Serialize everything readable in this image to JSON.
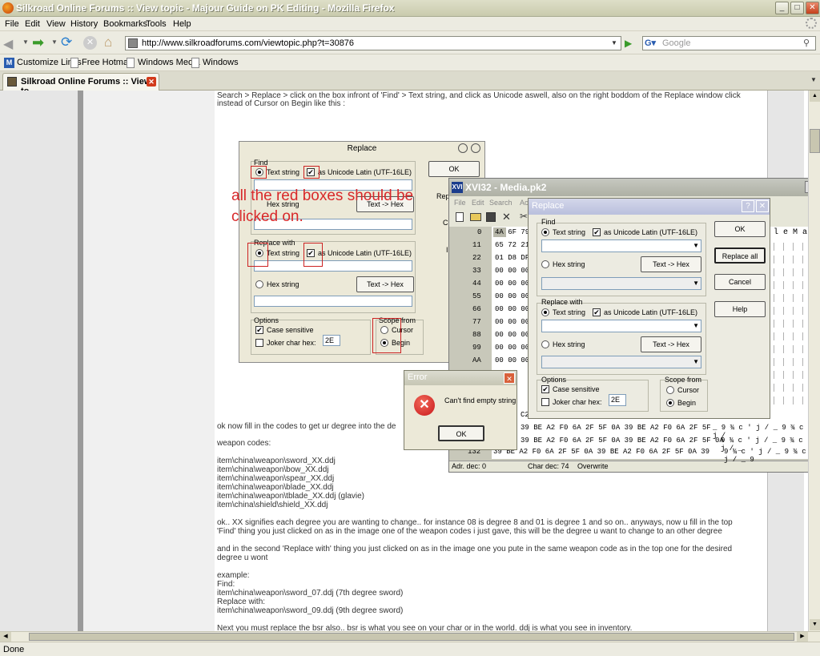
{
  "window": {
    "title": "Silkroad Online Forums :: View topic - Majour Guide on PK Editing - Mozilla Firefox"
  },
  "menu": [
    "File",
    "Edit",
    "View",
    "History",
    "Bookmarks",
    "Tools",
    "Help"
  ],
  "nav": {
    "url": "http://www.silkroadforums.com/viewtopic.php?t=30876",
    "search_placeholder": "Google"
  },
  "bookmarks": [
    "Customize Links",
    "Free Hotmail",
    "Windows Media",
    "Windows"
  ],
  "tab": {
    "label": "Silkroad Online Forums :: View to..."
  },
  "post": {
    "intro": [
      "Search > Replace > click on the box infront of 'Find' > Text string, and click as Unicode aswell, also on the right boddom of the Replace window click",
      "instead of Cursor on Begin like this :"
    ],
    "after_image": "ok now fill in the codes to get ur degree into the de",
    "weapon_codes_label": "weapon codes:",
    "codes": [
      "item\\china\\weapon\\sword_XX.ddj",
      "item\\china\\weapon\\bow_XX.ddj",
      "item\\china\\weapon\\spear_XX.ddj",
      "item\\china\\weapon\\blade_XX.ddj",
      "item\\china\\weapon\\tblade_XX.ddj (glavie)",
      "item\\china\\shield\\shield_XX.ddj"
    ],
    "para1": [
      "ok.. XX signifies each degree you are wanting to change.. for instance 08 is degree 8 and 01 is degree 1 and so on.. anyways, now u fill in the top",
      "'Find' thing you just clicked on as in the image one of the weapon codes i just gave, this will be the degree u want to change to an other degree"
    ],
    "para2": [
      "and in the second 'Replace with' thing you just clicked on as in the image one you pute in the same weapon code as in the top one for the desired",
      "degree u wont"
    ],
    "example": [
      "example:",
      "Find:",
      "item\\china\\weapon\\sword_07.ddj (7th degree sword)",
      "Replace with:",
      "item\\china\\weapon\\sword_09.ddj (9th degree sword)"
    ],
    "last": "Next you must replace the bsr also.. bsr is what you see on your char or in the world. ddj is what you see in inventory."
  },
  "small_dialog": {
    "title": "Replace",
    "find": "Find",
    "text_string": "Text string",
    "unicode": "as Unicode Latin (UTF-16LE)",
    "hex_string": "Hex string",
    "text_to_hex": "Text -> Hex",
    "replace_with": "Replace with",
    "options": "Options",
    "case": "Case sensitive",
    "joker": "Joker char hex:",
    "joker_val": "2E",
    "scope": "Scope from",
    "cursor": "Cursor",
    "begin": "Begin",
    "ok": "OK",
    "rep": "Rep",
    "c": "C",
    "i": "I"
  },
  "annotation": [
    "all the red boxes should be",
    "clicked on."
  ],
  "hex_window": {
    "title": "XVI32 - Media.pk2",
    "menu": [
      "File",
      "Edit",
      "Search",
      "Ac"
    ],
    "offsets": [
      "0",
      "11",
      "22",
      "33",
      "44",
      "55",
      "66",
      "77",
      "88",
      "99",
      "AA"
    ],
    "row0": "4A 6F 79",
    "row1": "65 72 21",
    "row2": "01 D8 DF",
    "zero": "00 00 00",
    "c2": "C2",
    "bottom_rows": [
      {
        "off": "",
        "hex": "39 BE A2 F0 6A 2F 5F 0A 39 BE A2 F0 6A 2F 5F",
        "txt": "_  9 ¾ c ' j /  _  9 ¾ c ' j /"
      },
      {
        "off": "",
        "hex": "39 BE A2 F0 6A 2F 5F 0A 39 BE A2 F0 6A 2F 5F 0A",
        "txt": "9 ¾ c ' j / _  9 ¾ c ' j / _"
      },
      {
        "off": "132",
        "hex": "39 BE A2 F0 6A 2F 5F 0A 39 BE A2 F0 6A 2F 5F 0A 39",
        "txt": "9 ¾ c ' j / _  9 ¾ c ' j / _  9"
      }
    ],
    "status": {
      "adr": "Adr. dec: 0",
      "chr": "Char dec: 74",
      "mode": "Overwrite"
    },
    "right_chars": "l e M a n"
  },
  "replace_window": {
    "title": "Replace",
    "find": "Find",
    "text_string": "Text string",
    "unicode": "as Unicode Latin (UTF-16LE)",
    "hex_string": "Hex string",
    "text_to_hex": "Text -> Hex",
    "replace_with": "Replace with",
    "options": "Options",
    "case": "Case sensitive",
    "joker": "Joker char hex:",
    "joker_val": "2E",
    "scope": "Scope from",
    "cursor": "Cursor",
    "begin": "Begin",
    "ok": "OK",
    "replace_all": "Replace all",
    "cancel": "Cancel",
    "help": "Help"
  },
  "error": {
    "title": "Error",
    "message": "Can't find empty string",
    "ok": "OK"
  },
  "statusbar": {
    "text": "Done"
  }
}
